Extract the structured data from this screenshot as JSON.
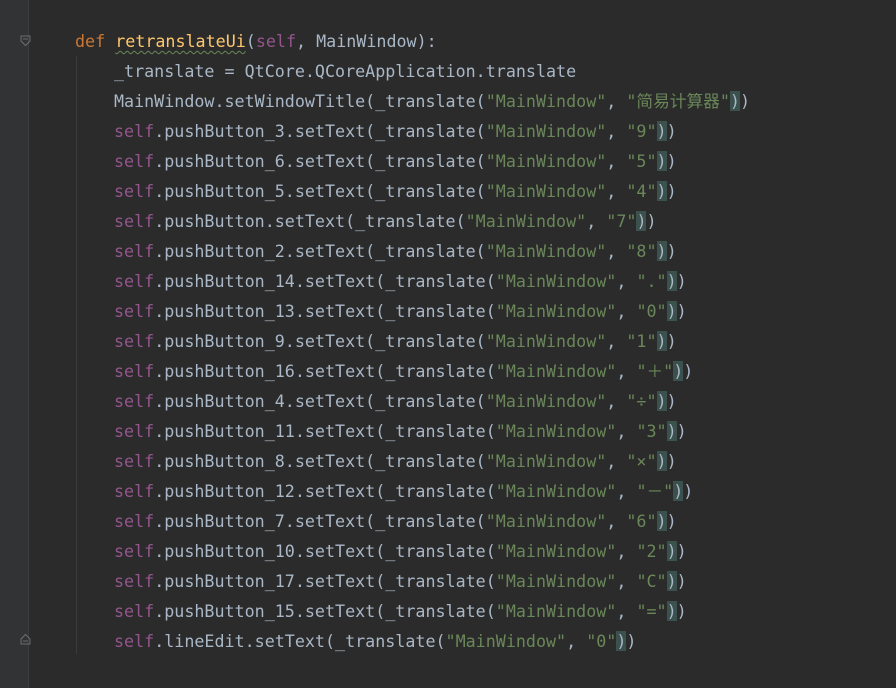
{
  "editor": {
    "def_keyword": "def",
    "function_name": "retranslateUi",
    "open_paren": "(",
    "self_param": "self",
    "params_rest": ", MainWindow):",
    "lines": [
      {
        "prefix": "",
        "obj": "_translate = QtCore.QCoreApplication.translate",
        "call": "",
        "ctx": "",
        "sep": "",
        "value": "",
        "close": ""
      },
      {
        "prefix": "",
        "obj": "MainWindow.setWindowTitle(_translate(",
        "call": "",
        "ctx": "\"MainWindow\"",
        "sep": ", ",
        "value": "\"简易计算器\"",
        "close": "))"
      },
      {
        "prefix": "self",
        "obj": ".pushButton_3.setText(_translate(",
        "ctx": "\"MainWindow\"",
        "sep": ", ",
        "value": "\"9\"",
        "close": "))"
      },
      {
        "prefix": "self",
        "obj": ".pushButton_6.setText(_translate(",
        "ctx": "\"MainWindow\"",
        "sep": ", ",
        "value": "\"5\"",
        "close": "))"
      },
      {
        "prefix": "self",
        "obj": ".pushButton_5.setText(_translate(",
        "ctx": "\"MainWindow\"",
        "sep": ", ",
        "value": "\"4\"",
        "close": "))"
      },
      {
        "prefix": "self",
        "obj": ".pushButton.setText(_translate(",
        "ctx": "\"MainWindow\"",
        "sep": ", ",
        "value": "\"7\"",
        "close": "))"
      },
      {
        "prefix": "self",
        "obj": ".pushButton_2.setText(_translate(",
        "ctx": "\"MainWindow\"",
        "sep": ", ",
        "value": "\"8\"",
        "close": "))"
      },
      {
        "prefix": "self",
        "obj": ".pushButton_14.setText(_translate(",
        "ctx": "\"MainWindow\"",
        "sep": ", ",
        "value": "\".\"",
        "close": "))"
      },
      {
        "prefix": "self",
        "obj": ".pushButton_13.setText(_translate(",
        "ctx": "\"MainWindow\"",
        "sep": ", ",
        "value": "\"0\"",
        "close": "))"
      },
      {
        "prefix": "self",
        "obj": ".pushButton_9.setText(_translate(",
        "ctx": "\"MainWindow\"",
        "sep": ", ",
        "value": "\"1\"",
        "close": "))"
      },
      {
        "prefix": "self",
        "obj": ".pushButton_16.setText(_translate(",
        "ctx": "\"MainWindow\"",
        "sep": ", ",
        "value": "\"＋\"",
        "close": "))"
      },
      {
        "prefix": "self",
        "obj": ".pushButton_4.setText(_translate(",
        "ctx": "\"MainWindow\"",
        "sep": ", ",
        "value": "\"÷\"",
        "close": "))"
      },
      {
        "prefix": "self",
        "obj": ".pushButton_11.setText(_translate(",
        "ctx": "\"MainWindow\"",
        "sep": ", ",
        "value": "\"3\"",
        "close": "))"
      },
      {
        "prefix": "self",
        "obj": ".pushButton_8.setText(_translate(",
        "ctx": "\"MainWindow\"",
        "sep": ", ",
        "value": "\"×\"",
        "close": "))"
      },
      {
        "prefix": "self",
        "obj": ".pushButton_12.setText(_translate(",
        "ctx": "\"MainWindow\"",
        "sep": ", ",
        "value": "\"－\"",
        "close": "))"
      },
      {
        "prefix": "self",
        "obj": ".pushButton_7.setText(_translate(",
        "ctx": "\"MainWindow\"",
        "sep": ", ",
        "value": "\"6\"",
        "close": "))"
      },
      {
        "prefix": "self",
        "obj": ".pushButton_10.setText(_translate(",
        "ctx": "\"MainWindow\"",
        "sep": ", ",
        "value": "\"2\"",
        "close": "))"
      },
      {
        "prefix": "self",
        "obj": ".pushButton_17.setText(_translate(",
        "ctx": "\"MainWindow\"",
        "sep": ", ",
        "value": "\"C\"",
        "close": "))"
      },
      {
        "prefix": "self",
        "obj": ".pushButton_15.setText(_translate(",
        "ctx": "\"MainWindow\"",
        "sep": ", ",
        "value": "\"=\"",
        "close": "))"
      },
      {
        "prefix": "self",
        "obj": ".lineEdit.setText(_translate(",
        "ctx": "\"MainWindow\"",
        "sep": ", ",
        "value": "\"0\"",
        "close": "))"
      }
    ]
  },
  "colors": {
    "background": "#2b2b2b",
    "keyword": "#cc7832",
    "function_name": "#ffc66d",
    "self": "#94558d",
    "string": "#6a8759",
    "text": "#a9b7c6"
  },
  "icons": [
    "fold-open-icon",
    "fold-close-icon"
  ]
}
